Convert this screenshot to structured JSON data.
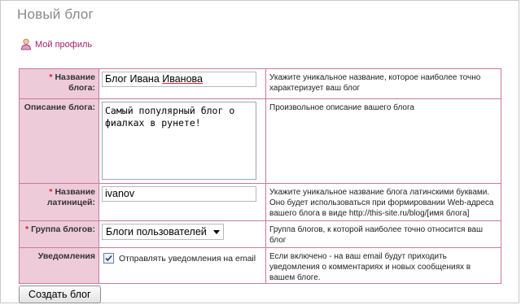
{
  "page": {
    "title": "Новый блог"
  },
  "profile_link": {
    "label": "Мой профиль",
    "icon": "user-icon"
  },
  "form": {
    "required_mark": "*",
    "fields": {
      "name": {
        "label": "Название блога:",
        "value_first": "Блог Ивана ",
        "value_last": "Иванова",
        "hint": "Укажите уникальное название, которое наиболее точно характеризует ваш блог"
      },
      "description": {
        "label": "Описание блога:",
        "value": "Самый популярный блог о фиалках в рунете!",
        "hint": "Произвольное описание вашего блога"
      },
      "latin_name": {
        "label": "Название латиницей:",
        "value": "ivanov",
        "hint": "Укажите уникальное название блога латинскими буквами. Оно будет использоваться при формировании Web-адреса вашего блога в виде http://this-site.ru/blog/[имя блога]"
      },
      "group": {
        "label": "Группа блогов:",
        "selected": "Блоги пользователей",
        "hint": "Группа блогов, к которой наиболее точно относится ваш блог"
      },
      "notifications": {
        "label": "Уведомления",
        "checkbox_label": "Отправлять уведомления на email",
        "checked": true,
        "hint": "Если включено - на ваш email будут приходить уведомления о комментариях и новых сообщениях в вашем блоге."
      }
    },
    "submit_label": "Создать блог"
  },
  "colors": {
    "label_bg": "#eecbd9",
    "border": "#c97a9a",
    "required": "#e0182b",
    "link": "#a0206a"
  }
}
